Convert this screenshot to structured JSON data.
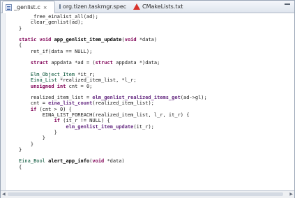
{
  "tabs": [
    {
      "label": "_genlist.c",
      "close": "⨯",
      "icon": "c-source-file-icon"
    },
    {
      "label": "org.tizen.taskmgr.spec",
      "icon": "spec-file-icon"
    },
    {
      "label": "CMakeLists.txt",
      "icon": "cmake-icon"
    }
  ],
  "code_lines": [
    "    _free_einalist_all(ad);",
    "    clear_genlist(ad);",
    "}",
    "",
    "static void app_genlist_item_update(void *data)",
    "{",
    "    ret_if(data == NULL);",
    "",
    "    struct appdata *ad = (struct appdata *)data;",
    "",
    "    Elm_Object_Item *it_r;",
    "    Eina_List *realized_item_list, *l_r;",
    "    unsigned int cnt = 0;",
    "",
    "    realized_item_list = elm_genlist_realized_items_get(ad->gl);",
    "    cnt = eina_list_count(realized_item_list);",
    "    if (cnt > 0) {",
    "        EINA_LIST_FOREACH(realized_item_list, l_r, it_r) {",
    "            if (it_r != NULL) {",
    "                elm_genlist_item_update(it_r);",
    "            }",
    "        }",
    "    }",
    "}",
    "",
    "Eina_Bool alert_app_info(void *data)",
    "{",
    "    "
  ],
  "colors": {
    "keyword": "#7f0055",
    "type": "#005032",
    "function_call": "#642880"
  }
}
